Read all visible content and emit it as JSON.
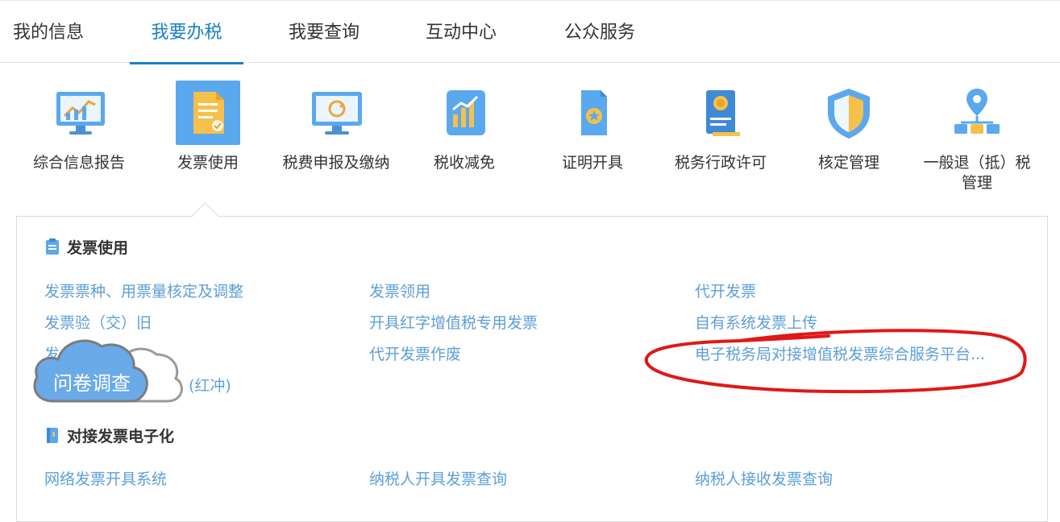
{
  "nav": {
    "tabs": [
      "我的信息",
      "我要办税",
      "我要查询",
      "互动中心",
      "公众服务"
    ],
    "active_index": 1
  },
  "categories": [
    {
      "label": "综合信息报告",
      "icon": "monitor-chart-icon"
    },
    {
      "label": "发票使用",
      "icon": "invoice-doc-icon"
    },
    {
      "label": "税费申报及缴纳",
      "icon": "monitor-refresh-icon"
    },
    {
      "label": "税收减免",
      "icon": "bar-chart-icon"
    },
    {
      "label": "证明开具",
      "icon": "certificate-doc-icon"
    },
    {
      "label": "税务行政许可",
      "icon": "license-award-icon"
    },
    {
      "label": "核定管理",
      "icon": "shield-icon"
    },
    {
      "label": "一般退（抵）税管理",
      "icon": "location-network-icon"
    }
  ],
  "panel": {
    "sections": [
      {
        "title": "发票使用",
        "links": [
          [
            "发票票种、用票量核定及调整",
            "发票领用",
            "代开发票"
          ],
          [
            "发票验（交）旧",
            "开具红字增值税专用发票",
            "自有系统发票上传"
          ],
          [
            "发",
            "代开发票作废",
            "电子税务局对接增值税发票综合服务平台..."
          ],
          [
            "(红冲)",
            "",
            ""
          ]
        ]
      },
      {
        "title": "对接发票电子化",
        "links": [
          [
            "网络发票开具系统",
            "纳税人开具发票查询",
            "纳税人接收发票查询"
          ]
        ]
      }
    ]
  },
  "survey": {
    "label": "问卷调查"
  },
  "colors": {
    "accent": "#1a7fc6",
    "link": "#5d9fd8",
    "annotation": "#e01818"
  }
}
